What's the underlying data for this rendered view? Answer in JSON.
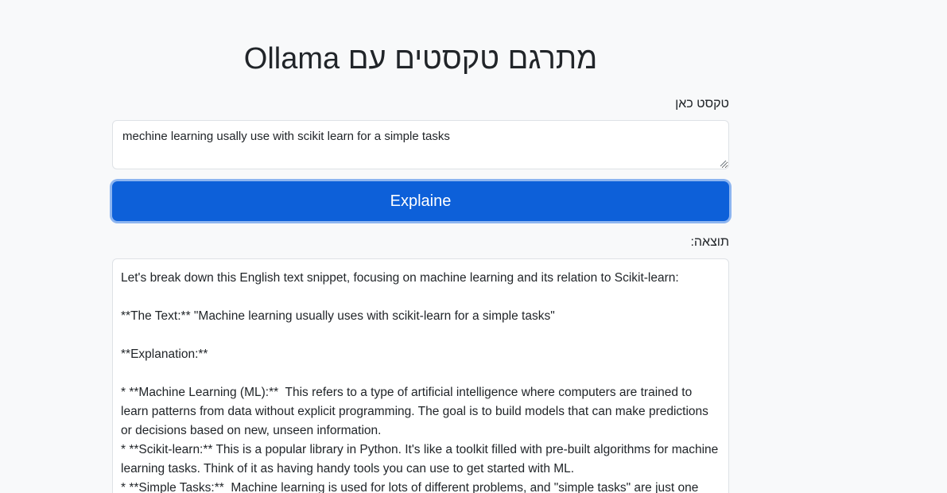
{
  "page": {
    "title": "מתרגם טקסטים עם Ollama",
    "input_label": "טקסט כאן",
    "output_label": "תוצאה:"
  },
  "input": {
    "value": "mechine learning usally use with scikit learn for a simple tasks"
  },
  "button": {
    "label": "Explaine",
    "color": "#0d60d9"
  },
  "output": {
    "text": "Let's break down this English text snippet, focusing on machine learning and its relation to Scikit-learn:\n\n**The Text:** \"Machine learning usually uses with scikit-learn for a simple tasks\"\n\n**Explanation:**\n\n* **Machine Learning (ML):**  This refers to a type of artificial intelligence where computers are trained to learn patterns from data without explicit programming. The goal is to build models that can make predictions or decisions based on new, unseen information.\n* **Scikit-learn:** This is a popular library in Python. It's like a toolkit filled with pre-built algorithms for machine learning tasks. Think of it as having handy tools you can use to get started with ML.\n* **Simple Tasks:**  Machine learning is used for lots of different problems, and \"simple tasks\" are just one"
  },
  "colors": {
    "background": "#f8f9fa",
    "border": "#dee2e6",
    "button_focus_ring": "#8db5f0"
  }
}
